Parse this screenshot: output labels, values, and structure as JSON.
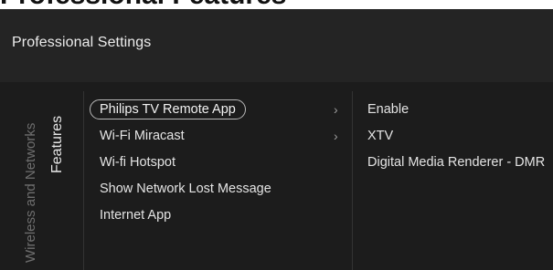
{
  "page_heading": "Professional Features",
  "header": {
    "title": "Professional Settings"
  },
  "breadcrumb": {
    "parent": "Wireless and Networks",
    "current": "Features"
  },
  "menu": {
    "items": [
      {
        "label": "Philips TV Remote App",
        "selected": true,
        "has_submenu": true,
        "chevron": "›"
      },
      {
        "label": "Wi-Fi Miracast",
        "selected": false,
        "has_submenu": true,
        "chevron": "›"
      },
      {
        "label": "Wi-fi Hotspot",
        "selected": false,
        "has_submenu": false
      },
      {
        "label": "Show Network Lost Message",
        "selected": false,
        "has_submenu": false
      },
      {
        "label": "Internet App",
        "selected": false,
        "has_submenu": false
      }
    ]
  },
  "submenu": {
    "items": [
      {
        "label": "Enable"
      },
      {
        "label": "XTV"
      },
      {
        "label": "Digital Media Renderer - DMR"
      }
    ]
  },
  "colors": {
    "background": "#1c1c1c",
    "header": "#242424",
    "text": "#e4e4e4",
    "muted": "#6e6e6e"
  }
}
